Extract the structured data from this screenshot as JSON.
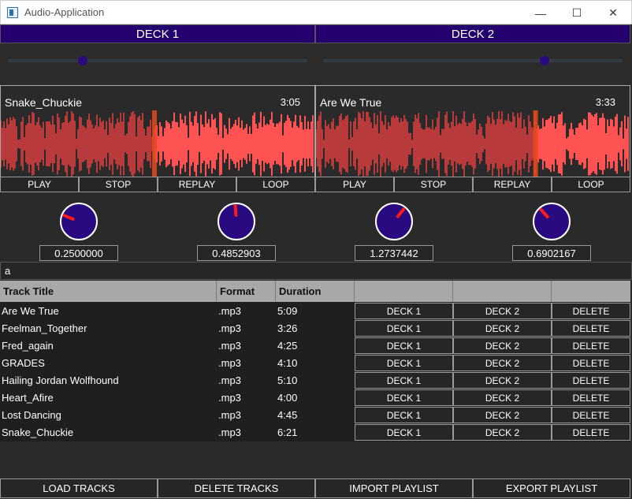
{
  "window": {
    "title": "Audio-Application",
    "minimize": "—",
    "maximize": "☐",
    "close": "✕"
  },
  "decks": [
    {
      "header": "DECK 1",
      "volume": 0.25,
      "track_title": "Snake_Chuckie",
      "track_duration": "3:05",
      "playhead": 0.49,
      "buttons": [
        "PLAY",
        "STOP",
        "REPLAY",
        "LOOP"
      ],
      "knobs": [
        {
          "value": "0.2500000",
          "level": 0.25
        },
        {
          "value": "0.4852903",
          "level": 0.485
        }
      ]
    },
    {
      "header": "DECK 2",
      "volume": 0.74,
      "track_title": "Are We True",
      "track_duration": "3:33",
      "playhead": 0.7,
      "buttons": [
        "PLAY",
        "STOP",
        "REPLAY",
        "LOOP"
      ],
      "knobs": [
        {
          "value": "1.2737442",
          "level": 0.64
        },
        {
          "value": "0.6902167",
          "level": 0.345
        }
      ]
    }
  ],
  "search": {
    "value": "a"
  },
  "table": {
    "headers": [
      "Track Title",
      "Format",
      "Duration",
      "",
      "",
      ""
    ],
    "rows": [
      {
        "title": "Are We True",
        "format": ".mp3",
        "duration": "5:09"
      },
      {
        "title": "Feelman_Together",
        "format": ".mp3",
        "duration": "3:26"
      },
      {
        "title": "Fred_again",
        "format": ".mp3",
        "duration": "4:25"
      },
      {
        "title": "GRADES",
        "format": ".mp3",
        "duration": "4:10"
      },
      {
        "title": "Hailing Jordan Wolfhound",
        "format": ".mp3",
        "duration": "5:10"
      },
      {
        "title": "Heart_Afire",
        "format": ".mp3",
        "duration": "4:00"
      },
      {
        "title": "Lost Dancing",
        "format": ".mp3",
        "duration": "4:45"
      },
      {
        "title": "Snake_Chuckie",
        "format": ".mp3",
        "duration": "6:21"
      }
    ],
    "row_buttons": {
      "deck1": "DECK 1",
      "deck2": "DECK 2",
      "delete": "DELETE"
    }
  },
  "bottom_buttons": [
    "LOAD TRACKS",
    "DELETE TRACKS",
    "IMPORT PLAYLIST",
    "EXPORT PLAYLIST"
  ],
  "colors": {
    "deck_header": "#24006e",
    "knob": "#2a0a80",
    "wave_played": "#b83a3a",
    "wave_unplayed": "#ff5252",
    "playhead": "#e84a1a",
    "pointer": "#ff1a1a"
  }
}
